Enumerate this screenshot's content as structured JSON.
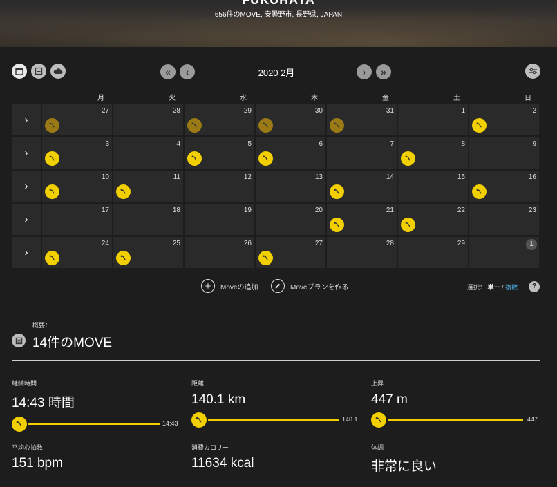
{
  "hero": {
    "title": "FUKUHAYA",
    "subtitle": "656件のMOVE, 安曇野市, 長野県, JAPAN"
  },
  "toolbar": {
    "view_icons": [
      "calendar-icon",
      "list-icon",
      "cloud-icon"
    ],
    "prev_year_icon": "double-chevron-left-icon",
    "prev_month_icon": "chevron-left-icon",
    "month_label": "2020 2月",
    "next_month_icon": "chevron-right-icon",
    "next_year_icon": "double-chevron-right-icon",
    "filter_icon": "sliders-icon"
  },
  "calendar": {
    "weekdays": [
      "月",
      "火",
      "水",
      "木",
      "金",
      "土",
      "日"
    ],
    "colors": {
      "past_activity": "#9a7a14",
      "activity": "#f2d000"
    },
    "weeks": [
      {
        "days": [
          {
            "day": "27",
            "activity": "past"
          },
          {
            "day": "28",
            "activity": "none"
          },
          {
            "day": "29",
            "activity": "past"
          },
          {
            "day": "30",
            "activity": "past"
          },
          {
            "day": "31",
            "activity": "past"
          },
          {
            "day": "1",
            "activity": "none"
          },
          {
            "day": "2",
            "activity": "current"
          }
        ]
      },
      {
        "days": [
          {
            "day": "3",
            "activity": "current"
          },
          {
            "day": "4",
            "activity": "none"
          },
          {
            "day": "5",
            "activity": "current"
          },
          {
            "day": "6",
            "activity": "current"
          },
          {
            "day": "7",
            "activity": "none"
          },
          {
            "day": "8",
            "activity": "current"
          },
          {
            "day": "9",
            "activity": "none"
          }
        ]
      },
      {
        "days": [
          {
            "day": "10",
            "activity": "current"
          },
          {
            "day": "11",
            "activity": "current"
          },
          {
            "day": "12",
            "activity": "none"
          },
          {
            "day": "13",
            "activity": "none"
          },
          {
            "day": "14",
            "activity": "current"
          },
          {
            "day": "15",
            "activity": "none"
          },
          {
            "day": "16",
            "activity": "current"
          }
        ]
      },
      {
        "days": [
          {
            "day": "17",
            "activity": "none"
          },
          {
            "day": "18",
            "activity": "none"
          },
          {
            "day": "19",
            "activity": "none"
          },
          {
            "day": "20",
            "activity": "none"
          },
          {
            "day": "21",
            "activity": "current"
          },
          {
            "day": "22",
            "activity": "current"
          },
          {
            "day": "23",
            "activity": "none"
          }
        ]
      },
      {
        "days": [
          {
            "day": "24",
            "activity": "current"
          },
          {
            "day": "25",
            "activity": "current"
          },
          {
            "day": "26",
            "activity": "none"
          },
          {
            "day": "27",
            "activity": "current"
          },
          {
            "day": "28",
            "activity": "none"
          },
          {
            "day": "29",
            "activity": "none"
          },
          {
            "day": "1",
            "activity": "none",
            "badge": true
          }
        ]
      }
    ]
  },
  "actions": {
    "add_move": "Moveの追加",
    "create_plan": "Moveプランを作る",
    "select_label": "選択：",
    "single": "単一",
    "separator": " / ",
    "multiple": "複数",
    "help": "?"
  },
  "summary": {
    "label": "概要：",
    "title": "14件のMOVE",
    "stats": {
      "duration": {
        "label": "継続時間",
        "value": "14:43",
        "unit": "時間",
        "bar_value": "14:43",
        "fill": 1.0
      },
      "distance": {
        "label": "距離",
        "value": "140.1",
        "unit": "km",
        "bar_value": "140.1",
        "fill": 1.0
      },
      "ascent": {
        "label": "上昇",
        "value": "447",
        "unit": "m",
        "bar_value": "447",
        "fill": 1.0
      },
      "heart_rate": {
        "label": "平均心拍数",
        "value": "151",
        "unit": "bpm"
      },
      "calories": {
        "label": "消費カロリー",
        "value": "11634",
        "unit": "kcal"
      },
      "feeling": {
        "label": "体調",
        "value": "非常に良い"
      }
    }
  }
}
